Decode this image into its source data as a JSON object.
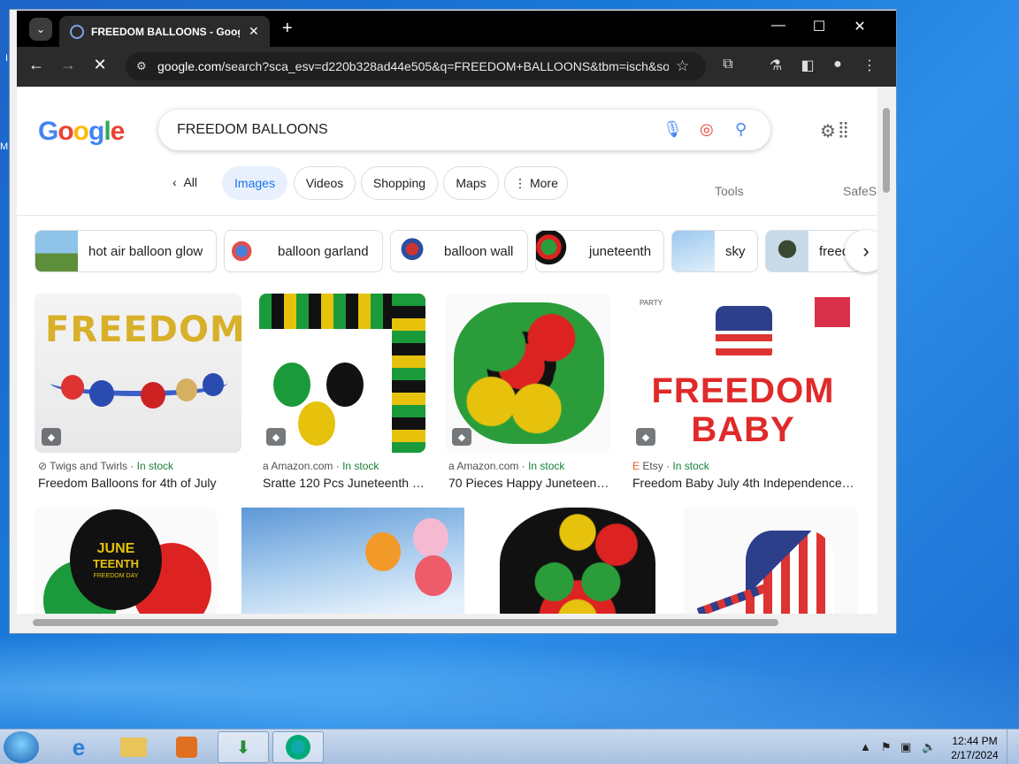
{
  "tab": {
    "title": "FREEDOM BALLOONS - Google"
  },
  "omnibox": {
    "domain": "google.com",
    "path": "/search?sca_esv=d220b328ad44e505&q=FREEDOM+BALLOONS&tbm=isch&so..."
  },
  "search": {
    "query": "FREEDOM BALLOONS"
  },
  "filters": {
    "all": "All",
    "images": "Images",
    "videos": "Videos",
    "shopping": "Shopping",
    "maps": "Maps",
    "more": "More",
    "tools": "Tools",
    "safesearch": "SafeS"
  },
  "related": [
    {
      "label": "hot air balloon glow"
    },
    {
      "label": "balloon garland"
    },
    {
      "label": "balloon wall"
    },
    {
      "label": "juneteenth"
    },
    {
      "label": "sky"
    },
    {
      "label": "freed"
    }
  ],
  "results": [
    {
      "source": "Twigs and Twirls",
      "stock": "In stock",
      "title": "Freedom Balloons for 4th of July"
    },
    {
      "source": "Amazon.com",
      "stock": "In stock",
      "title": "Sratte 120 Pcs Juneteenth Ba..."
    },
    {
      "source": "Amazon.com",
      "stock": "In stock",
      "title": "70 Pieces Happy Juneteenth ..."
    },
    {
      "source": "Etsy",
      "stock": "In stock",
      "title": "Freedom Baby July 4th Independence Day ..."
    }
  ],
  "images": {
    "freedom": "FREEDOM",
    "freedom_baby_1": "FREEDOM",
    "freedom_baby_2": "BABY",
    "june": "JUNE",
    "teenth": "TEENTH",
    "freedom_day": "FREEDOM DAY",
    "party": "PARTY"
  },
  "taskbar": {
    "time": "12:44 PM",
    "date": "2/17/2024"
  },
  "colors": {
    "accent": "#1a73e8",
    "stock": "#188038"
  }
}
